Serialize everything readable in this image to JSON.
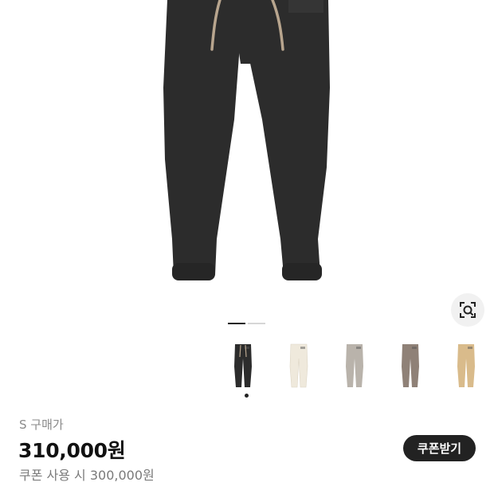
{
  "product": {
    "image_alt": "Sweatpants product image",
    "colorways": [
      {
        "name": "black",
        "color": "#2c2c2c",
        "selected": true
      },
      {
        "name": "cream",
        "color": "#efe9dc",
        "selected": false
      },
      {
        "name": "grey",
        "color": "#b9b3ab",
        "selected": false
      },
      {
        "name": "taupe",
        "color": "#8f8177",
        "selected": false
      },
      {
        "name": "sand",
        "color": "#d9bb8b",
        "selected": false
      }
    ],
    "gallery": {
      "pages": 2,
      "current_page": 1
    }
  },
  "pricing": {
    "size_label": "S 구매가",
    "price": "310,000원",
    "coupon_price_text": "쿠폰 사용 시 300,000원",
    "coupon_button_label": "쿠폰받기"
  },
  "icons": {
    "lens": "lens-search-icon"
  },
  "colors": {
    "accent": "#222222",
    "pants": "#2c2c2c",
    "drawcord": "#b8a58e"
  }
}
